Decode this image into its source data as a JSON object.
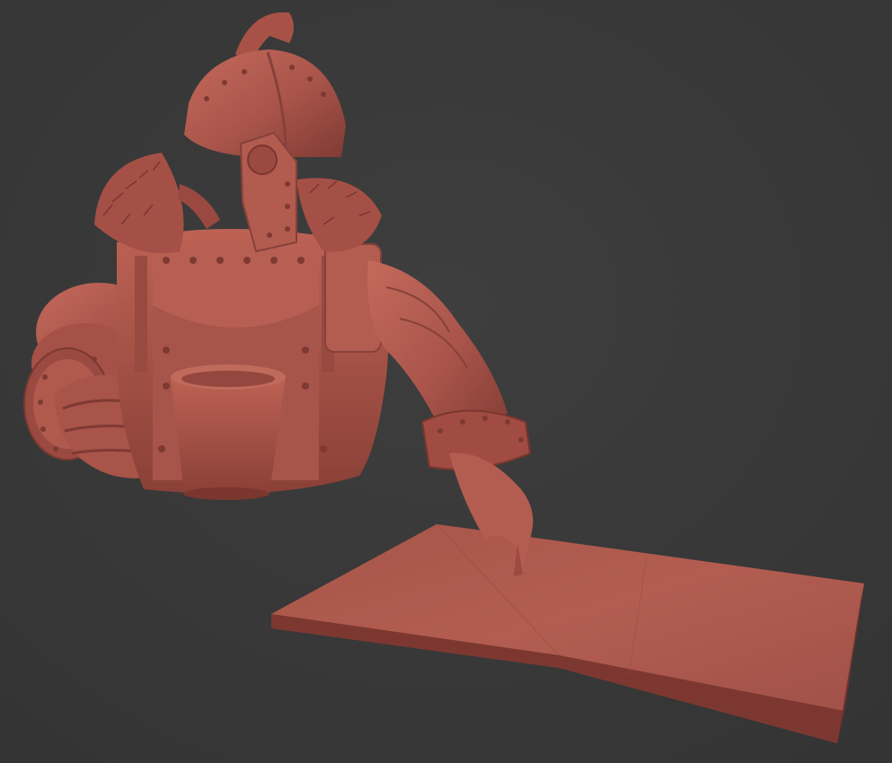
{
  "scene": {
    "background_color": "#3a3a3a",
    "clay_color": "#b0564a",
    "clay_shadow": "#7e3a32",
    "clay_highlight": "#c8685a"
  }
}
